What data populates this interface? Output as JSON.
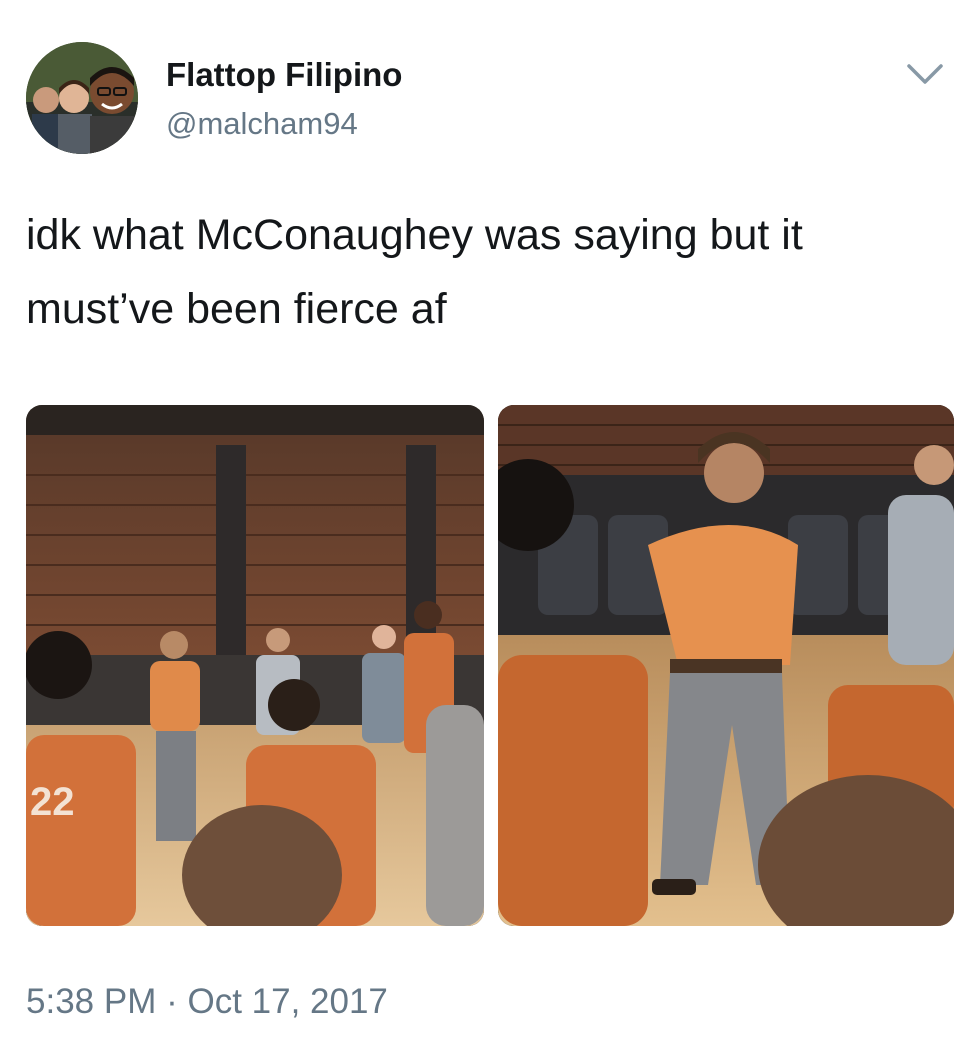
{
  "author": {
    "name": "Flattop Filipino",
    "handle": "@malcham94"
  },
  "tweet": {
    "text_line1": "idk what McConaughey was saying but it",
    "text_line2": "must’ve been fierce af",
    "time": "5:38 PM",
    "separator": " · ",
    "date": "Oct 17, 2017"
  },
  "photos": [
    {
      "subject": "basketball-practice-wide-shot"
    },
    {
      "subject": "basketball-practice-close-shot"
    }
  ],
  "icons": {
    "menu": "chevron-down-icon"
  },
  "colors": {
    "text": "#14171a",
    "secondary": "#657786",
    "jersey_orange": "#d2713a"
  }
}
